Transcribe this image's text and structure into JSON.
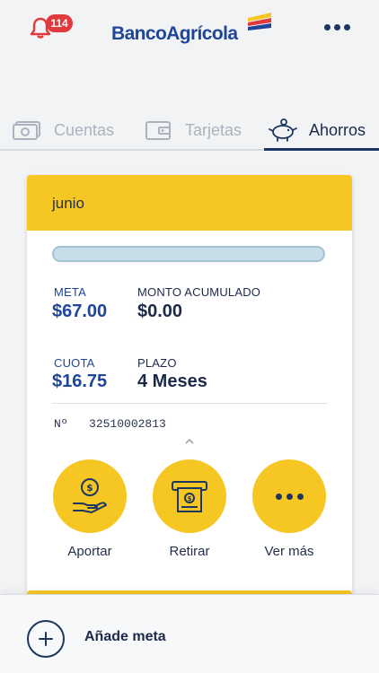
{
  "header": {
    "notifications_count": "114",
    "brand": "BancoAgrícola",
    "brand_colors": {
      "blue": "#1e4598",
      "yellow": "#f6c623",
      "red": "#e03a3e"
    }
  },
  "tabs": [
    {
      "label": "Cuentas",
      "icon": "bills-icon",
      "active": false
    },
    {
      "label": "Tarjetas",
      "icon": "wallet-icon",
      "active": false
    },
    {
      "label": "Ahorros",
      "icon": "piggy-bank-icon",
      "active": true
    }
  ],
  "goal_card": {
    "title": "junio",
    "progress_percent": 0,
    "meta_label": "META",
    "meta_value": "$67.00",
    "monto_label": "MONTO ACUMULADO",
    "monto_value": "$0.00",
    "cuota_label": "CUOTA",
    "cuota_value": "$16.75",
    "plazo_label": "PLAZO",
    "plazo_value": "4 Meses",
    "account_prefix": "Nº",
    "account_number": "32510002813",
    "actions": [
      {
        "label": "Aportar",
        "icon": "hand-coins-icon"
      },
      {
        "label": "Retirar",
        "icon": "atm-cash-icon"
      },
      {
        "label": "Ver más",
        "icon": "more-dots-icon"
      }
    ]
  },
  "footer": {
    "add_goal_label": "Añade meta"
  }
}
